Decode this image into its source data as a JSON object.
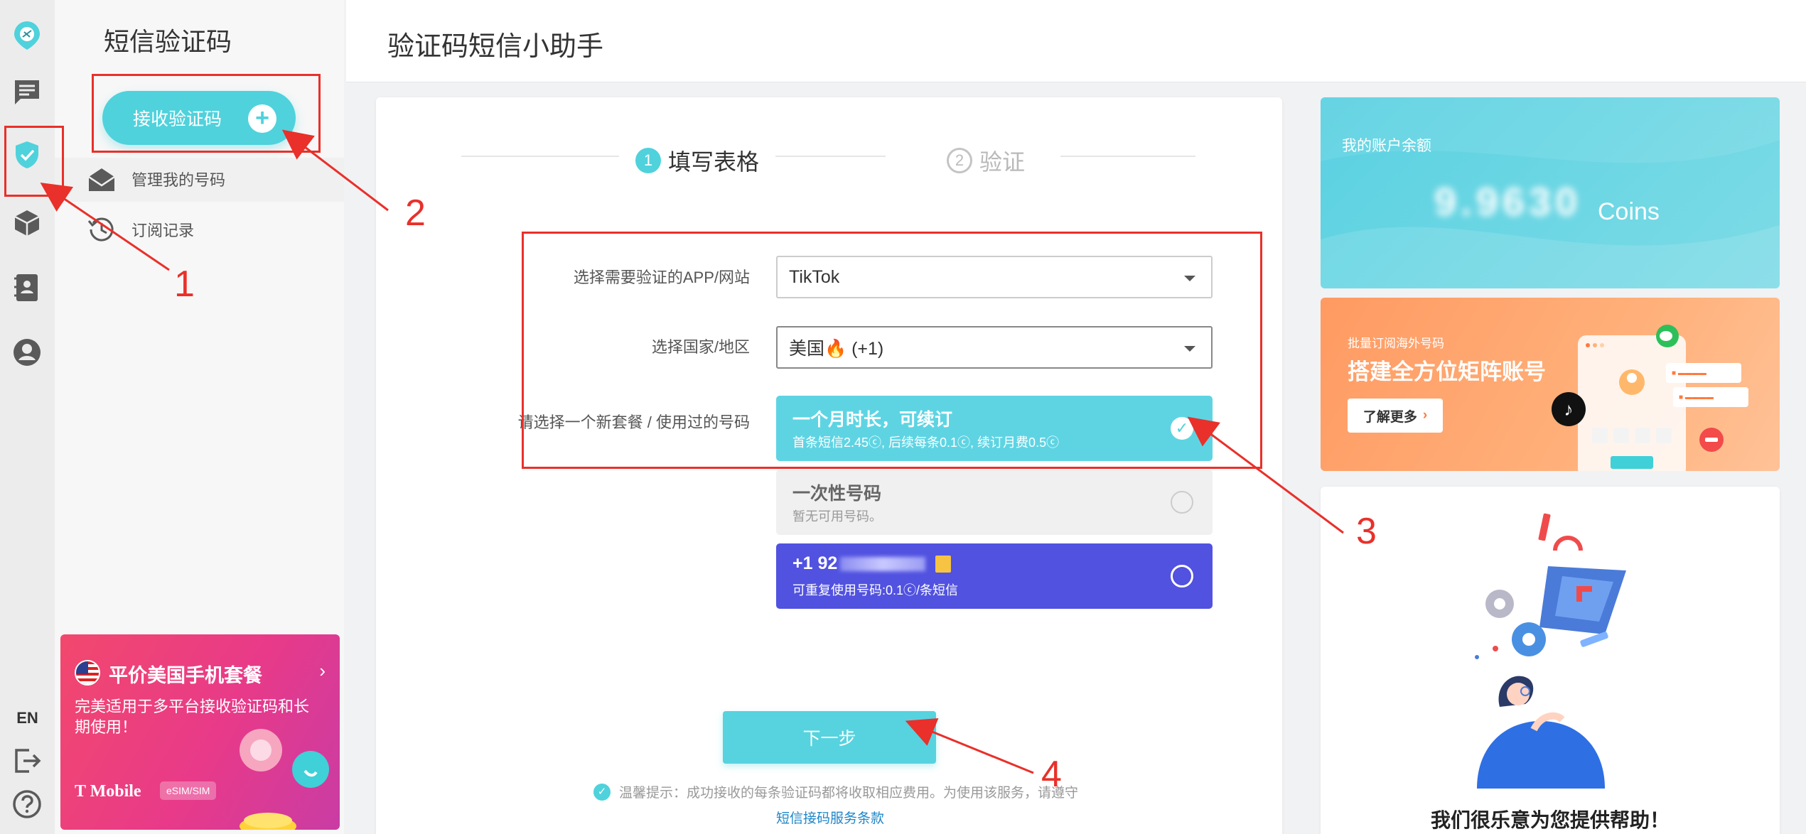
{
  "rail": {
    "items": [
      "logo-icon",
      "chat-icon",
      "shield-check-icon",
      "box-icon",
      "contacts-icon",
      "user-icon"
    ],
    "lang": "EN",
    "bottom": [
      "logout-icon",
      "help-icon"
    ]
  },
  "sidebar": {
    "title": "短信验证码",
    "receive_button": "接收验证码",
    "receive_plus": "+",
    "menu": [
      {
        "label": "管理我的号码",
        "icon": "envelope-open-icon"
      },
      {
        "label": "订阅记录",
        "icon": "history-icon"
      }
    ]
  },
  "promo": {
    "title": "平价美国手机套餐",
    "chevron": "›",
    "desc": "完美适用于多平台接收验证码和长期使用！",
    "brand": "T Mobile",
    "badge": "eSIM/SIM"
  },
  "header": {
    "title": "验证码短信小助手"
  },
  "steps": [
    {
      "num": "1",
      "label": "填写表格",
      "active": true
    },
    {
      "num": "2",
      "label": "验证",
      "active": false
    }
  ],
  "form": {
    "app_label": "选择需要验证的APP/网站",
    "app_value": "TikTok",
    "country_label": "选择国家/地区",
    "country_value": "美国🔥 (+1)",
    "plan_label": "请选择一个新套餐 / 使用过的号码",
    "options": [
      {
        "title": "一个月时长，可续订",
        "desc": "首条短信2.45ⓒ, 后续每条0.1ⓒ, 续订月费0.5ⓒ",
        "selected": true
      },
      {
        "title": "一次性号码",
        "desc": "暂无可用号码。",
        "selected": false
      },
      {
        "title": "+1 92",
        "desc": "可重复使用号码:0.1ⓒ/条短信",
        "selected": false
      }
    ],
    "next_button": "下一步",
    "tip_check": "✓",
    "tip": "温馨提示：成功接收的每条验证码都将收取相应费用。为使用该服务，请遵守",
    "terms_link": "短信接码服务条款"
  },
  "balance": {
    "label": "我的账户余额",
    "amount": "9.9630",
    "unit": "Coins"
  },
  "banner": {
    "subtitle": "批量订阅海外号码",
    "title": "搭建全方位矩阵账号",
    "more_label": "了解更多",
    "more_arrow": "›"
  },
  "help": {
    "title": "我们很乐意为您提供帮助！"
  },
  "annotations": [
    "1",
    "2",
    "3",
    "4"
  ],
  "colors": {
    "accent": "#4fd2dc",
    "purple": "#5152e0",
    "annotation": "#e9302a",
    "promo": "#f2486d"
  }
}
